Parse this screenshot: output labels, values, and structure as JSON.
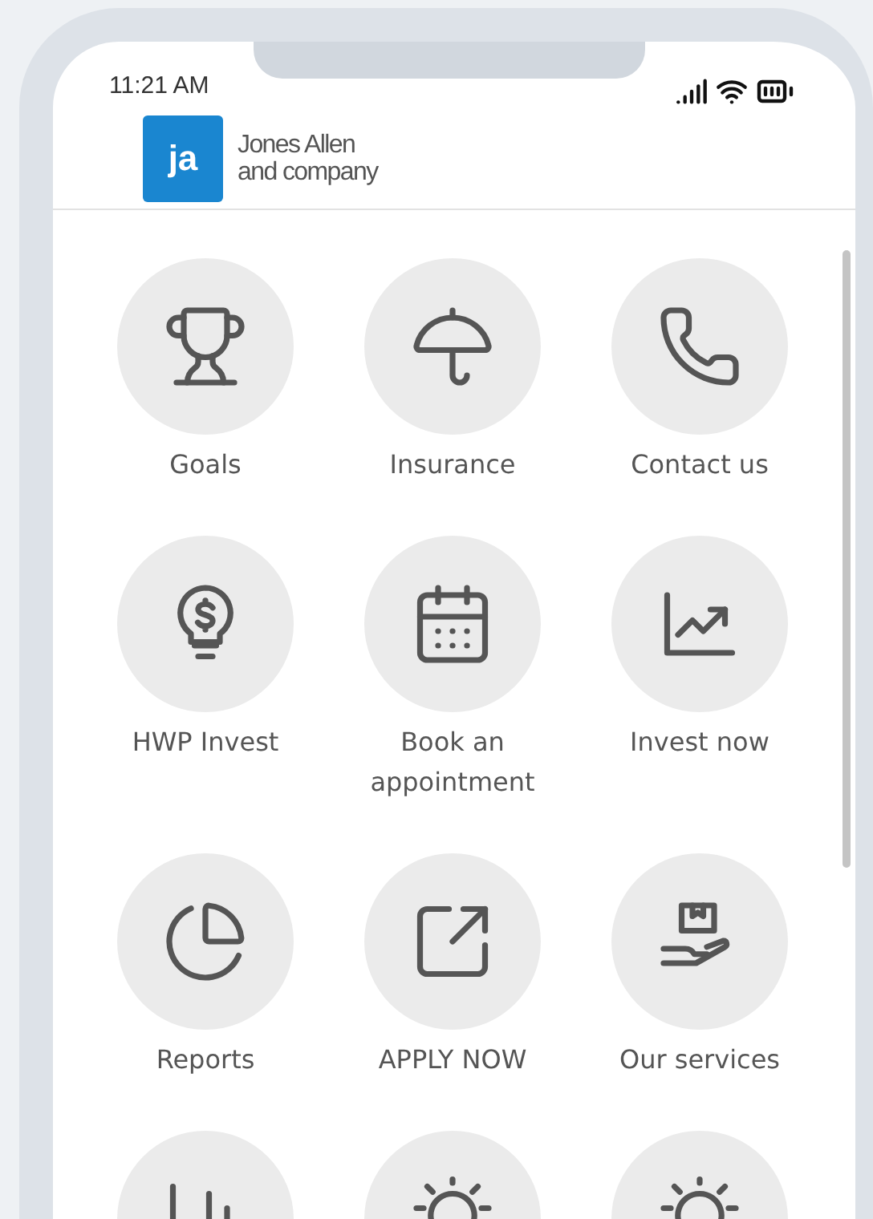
{
  "status_bar": {
    "time": "11:21 AM"
  },
  "logo": {
    "mark": "ja",
    "name_lines": [
      "Jones Allen",
      "and company"
    ]
  },
  "tiles": [
    {
      "label": "Goals"
    },
    {
      "label": "Insurance"
    },
    {
      "label": "Contact us"
    },
    {
      "label": "HWP Invest"
    },
    {
      "label": "Book an appointment"
    },
    {
      "label": "Invest now"
    },
    {
      "label": "Reports"
    },
    {
      "label": "APPLY NOW"
    },
    {
      "label": "Our services"
    }
  ]
}
